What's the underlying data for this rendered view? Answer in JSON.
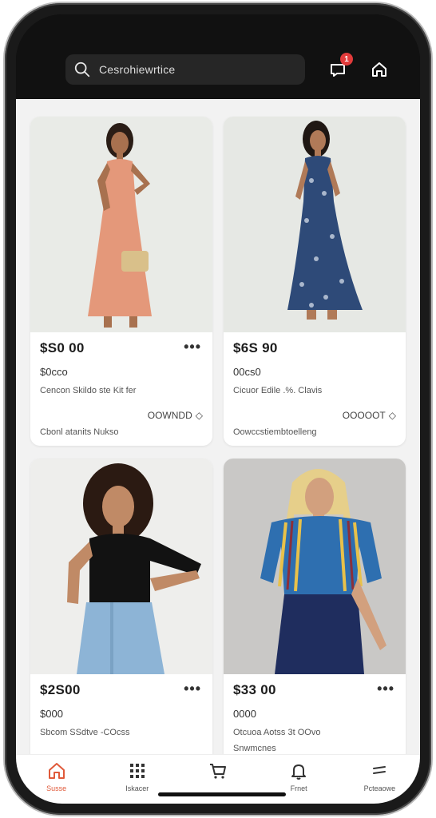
{
  "search": {
    "placeholder": "Cesrohiewrtice"
  },
  "header": {
    "notification_count": "1"
  },
  "products": [
    {
      "price": "$S0 00",
      "sub_price": "$0cco",
      "desc": "Cencon Skildo ste Kit fer",
      "meta": "OOWNDD",
      "footer": "Cbonl atanits Nukso"
    },
    {
      "price": "$6S 90",
      "sub_price": "00cs0",
      "desc": "Cicuor Edile .%. Clavis",
      "meta": "OOOOOT",
      "footer": "Oowccstiembtoelleng"
    },
    {
      "price": "$2S00",
      "sub_price": "$000",
      "desc": "Sbcom SSdtve -COcss",
      "meta": "",
      "footer": ""
    },
    {
      "price": "$33 00",
      "sub_price": "0000",
      "desc": "Otcuoa Aotss 3t OOvo",
      "meta": "",
      "footer": "Snwmcnes"
    }
  ],
  "more_label": "•••",
  "nav": [
    {
      "label": "Susse",
      "icon": "home-icon",
      "active": true
    },
    {
      "label": "Iskacer",
      "icon": "grid-icon",
      "active": false
    },
    {
      "label": "",
      "icon": "cart-icon",
      "active": false
    },
    {
      "label": "Frnet",
      "icon": "bell-icon",
      "active": false
    },
    {
      "label": "Pcteaowe",
      "icon": "menu-icon",
      "active": false
    }
  ],
  "colors": {
    "accent": "#e05a3a",
    "badge": "#e23b3b",
    "topbar": "#111111"
  }
}
